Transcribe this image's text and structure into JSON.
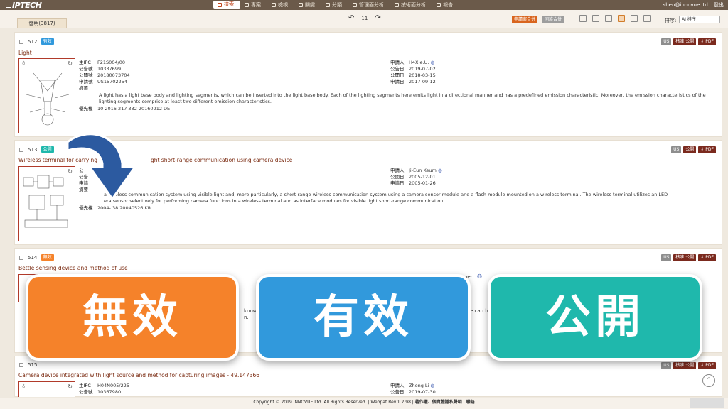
{
  "nav": {
    "logo": "IPTECH",
    "items": [
      {
        "label": "檢索",
        "active": true
      },
      {
        "label": "專案"
      },
      {
        "label": "檢視"
      },
      {
        "label": "關鍵"
      },
      {
        "label": "分類"
      },
      {
        "label": "管理面分析"
      },
      {
        "label": "技術面分析"
      },
      {
        "label": "報告"
      }
    ],
    "user": "shen@innovue.ltd",
    "logout": "登出"
  },
  "toolbar": {
    "page_number": "11",
    "btn_merge_apply": "申請案合併",
    "btn_merge_family": "同族合併",
    "sort_label": "排序:",
    "sort_value": "AI 排序",
    "tab_label": "發明(3817)"
  },
  "cards": [
    {
      "num": "512.",
      "status": "有效",
      "title": "Light",
      "ipc": "F21S004/00",
      "pub_no": "10337699",
      "open_no": "20180073704",
      "app_no": "US15702254",
      "applicant": "H4X e.U.",
      "pub_date": "2019-07-02",
      "open_date": "2018-03-15",
      "app_date": "2017-09-12",
      "abstract": "A light has a light base body and lighting segments, which can be inserted into the light base body. Each of the lighting segments here emits light in a directional manner and has a predefined emission characteristic. Moreover, the emission characteristics of the lighting segments comprise at least two different emission characteristics.",
      "priority": "10 2016 217 332  20160912  DE"
    },
    {
      "num": "513.",
      "status": "公開",
      "title_left": "Wireless terminal for carrying",
      "title_right": "ght short-range communication using camera device",
      "applicant": "Ji-Eun Keum",
      "pub_date": "2005-12-01",
      "app_date": "2005-01-26",
      "abstract": "a wireless communication system using visible light and, more particularly, a short-range wireless communication system using a camera sensor module and a flash module mounted on a wireless terminal. The wireless terminal utilizes an LED",
      "abstract2": "era sensor selectively for performing camera functions in a wireless terminal and as interface modules for visible light short-range communication.",
      "priority": "2004-    38  20040526  KR"
    },
    {
      "num": "514.",
      "status": "無效",
      "title": "Bettle sensing device and method of use",
      "frag1": "ner",
      "frag2": "known",
      "frag3": "n.",
      "frag4": "e catch"
    },
    {
      "num": "515.",
      "title": "Camera device integrated with light source and method for capturing images - 49.147366",
      "ipc": "H04N005/225",
      "pub_no": "10367980",
      "applicant": "Zheng Li",
      "pub_date": "2019-07-30"
    }
  ],
  "labels": {
    "ipc": "主IPC",
    "pub_no": "公告號",
    "open_no": "公開號",
    "app_no": "申請號",
    "abstract": "摘要",
    "priority": "優先權",
    "applicant": "申請人",
    "pub_date": "公告日",
    "open_date": "公開日",
    "app_date": "申請日",
    "us": "US",
    "ckeck": "核准",
    "open": "公開",
    "pdf": "PDF"
  },
  "overlays": {
    "invalid": "無效",
    "valid": "有效",
    "published": "公開"
  },
  "colors": {
    "invalid": "#f5822a",
    "valid": "#3199dc",
    "published": "#1fb8ac",
    "arrow": "#2c5aa0"
  },
  "footer": {
    "copyright": "Copyright © 2019 INNOVUE Ltd. All Rights Reserved. | Webpat Rev.1.2.98 |",
    "links": "著作權、個資體隱私聲明",
    "contact": "聯絡"
  }
}
